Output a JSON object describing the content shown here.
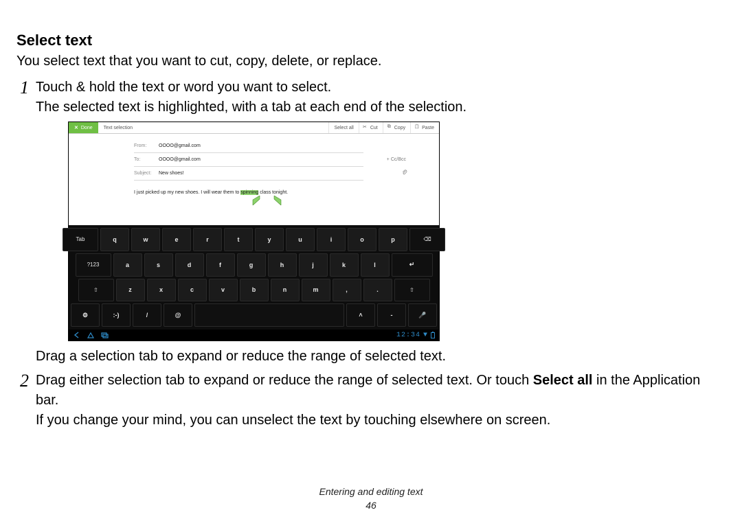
{
  "title": "Select text",
  "intro": "You select text that you want to cut, copy, delete, or replace.",
  "step1": {
    "num": "1",
    "line1": "Touch & hold the text or word you want to select.",
    "line2": "The selected text is highlighted, with a tab at each end of the selection.",
    "after": "Drag a selection tab to expand or reduce the range of selected text."
  },
  "step2": {
    "num": "2",
    "line_a": "Drag either selection tab to expand or reduce the range of selected text. Or touch ",
    "line_a_bold": "Select all",
    "line_a_tail": " in the Application bar.",
    "line_b": "If you change your mind, you can unselect the text by touching elsewhere on screen."
  },
  "footer": "Entering and editing text",
  "page": "46",
  "shot": {
    "ab": {
      "done": "Done",
      "title": "Text selection",
      "selectall": "Select all",
      "cut": "Cut",
      "copy": "Copy",
      "paste": "Paste"
    },
    "compose": {
      "from_l": "From:",
      "from_v": "OOOO@gmail.com",
      "to_l": "To:",
      "to_v": "OOOO@gmail.com",
      "ccbcc": "+ Cc/Bcc",
      "subj_l": "Subject:",
      "subj_v": "New shoes!",
      "body_a": "I just picked up my new shoes. I will wear them to ",
      "body_hl": "spinning",
      "body_b": " class tonight."
    },
    "keys": {
      "tab": "Tab",
      "r1": [
        "q",
        "w",
        "e",
        "r",
        "t",
        "y",
        "u",
        "i",
        "o",
        "p"
      ],
      "sym": "?123",
      "r2": [
        "a",
        "s",
        "d",
        "f",
        "g",
        "h",
        "j",
        "k",
        "l"
      ],
      "r3": [
        "z",
        "x",
        "c",
        "v",
        "b",
        "n",
        "m",
        ",",
        "."
      ],
      "smile": ":-)",
      "slash": "/",
      "at": "@",
      "dash": "-"
    },
    "clock": "12:34"
  }
}
